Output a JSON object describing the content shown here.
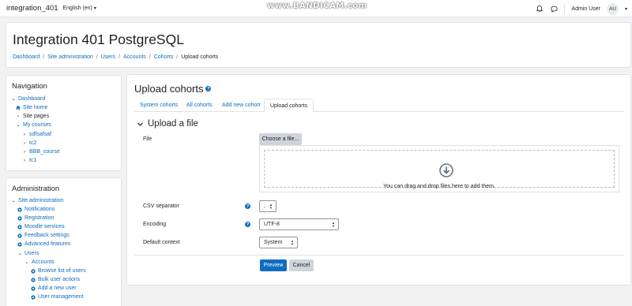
{
  "navbar": {
    "site_name": "integration_401",
    "language": "English (en)",
    "user_name": "Admin User",
    "avatar_initials": "AU"
  },
  "watermark": "www.BANDICAM.com",
  "header": {
    "title": "Integration 401 PostgreSQL",
    "breadcrumb": [
      "Dashboard",
      "Site administration",
      "Users",
      "Accounts",
      "Cohorts",
      "Upload cohorts"
    ]
  },
  "navigation": {
    "title": "Navigation",
    "items": [
      {
        "label": "Dashboard",
        "link": true
      },
      {
        "label": "Site home",
        "link": true
      },
      {
        "label": "Site pages",
        "link": false
      },
      {
        "label": "My courses",
        "link": true
      },
      {
        "label": "sdfsafsaf",
        "link": true
      },
      {
        "label": "tc2",
        "link": true
      },
      {
        "label": "BBB_course",
        "link": true
      },
      {
        "label": "tc1",
        "link": true
      }
    ]
  },
  "administration": {
    "title": "Administration",
    "items": [
      {
        "label": "Site administration"
      },
      {
        "label": "Notifications"
      },
      {
        "label": "Registration"
      },
      {
        "label": "Moodle services"
      },
      {
        "label": "Feedback settings"
      },
      {
        "label": "Advanced features"
      },
      {
        "label": "Users"
      },
      {
        "label": "Accounts"
      },
      {
        "label": "Browse list of users"
      },
      {
        "label": "Bulk user actions"
      },
      {
        "label": "Add a new user"
      },
      {
        "label": "User management"
      }
    ]
  },
  "main": {
    "title": "Upload cohorts",
    "tabs": [
      "System cohorts",
      "All cohorts",
      "Add new cohort",
      "Upload cohorts"
    ],
    "active_tab": "Upload cohorts",
    "section_title": "Upload a file",
    "file_label": "File",
    "choose_button": "Choose a file...",
    "dropzone_text": "You can drag and drop files here to add them.",
    "csv_label": "CSV separator",
    "csv_value": ",",
    "encoding_label": "Encoding",
    "encoding_value": "UTF-8",
    "context_label": "Default context",
    "context_value": "System",
    "preview_button": "Preview",
    "cancel_button": "Cancel"
  },
  "colors": {
    "accent": "#0f6cbf",
    "secondary_button": "#ced4da",
    "page_background": "#f2f2f2"
  }
}
